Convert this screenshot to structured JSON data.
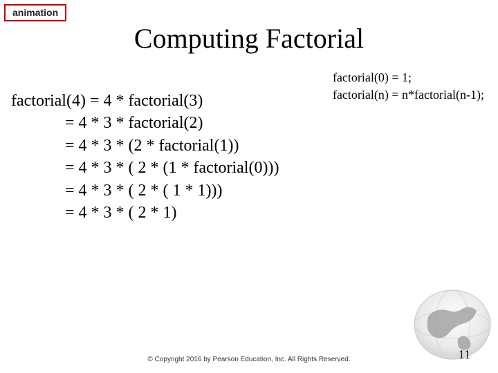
{
  "badge": {
    "label": "animation"
  },
  "title": "Computing Factorial",
  "rules": {
    "base": "factorial(0) = 1;",
    "rec": "factorial(n) = n*factorial(n-1);"
  },
  "derivation": {
    "lhs": "factorial(4) ",
    "lines": [
      "= 4 * factorial(3)",
      "= 4 * 3 * factorial(2)",
      "= 4 * 3 * (2 * factorial(1))",
      "= 4 * 3 * ( 2 * (1 * factorial(0)))",
      "= 4 * 3 * ( 2 * ( 1 * 1)))",
      "= 4 * 3 * ( 2 * 1)"
    ]
  },
  "footer": {
    "copyright": "© Copyright 2016 by Pearson Education, Inc. All Rights Reserved."
  },
  "page": {
    "number": "11"
  }
}
